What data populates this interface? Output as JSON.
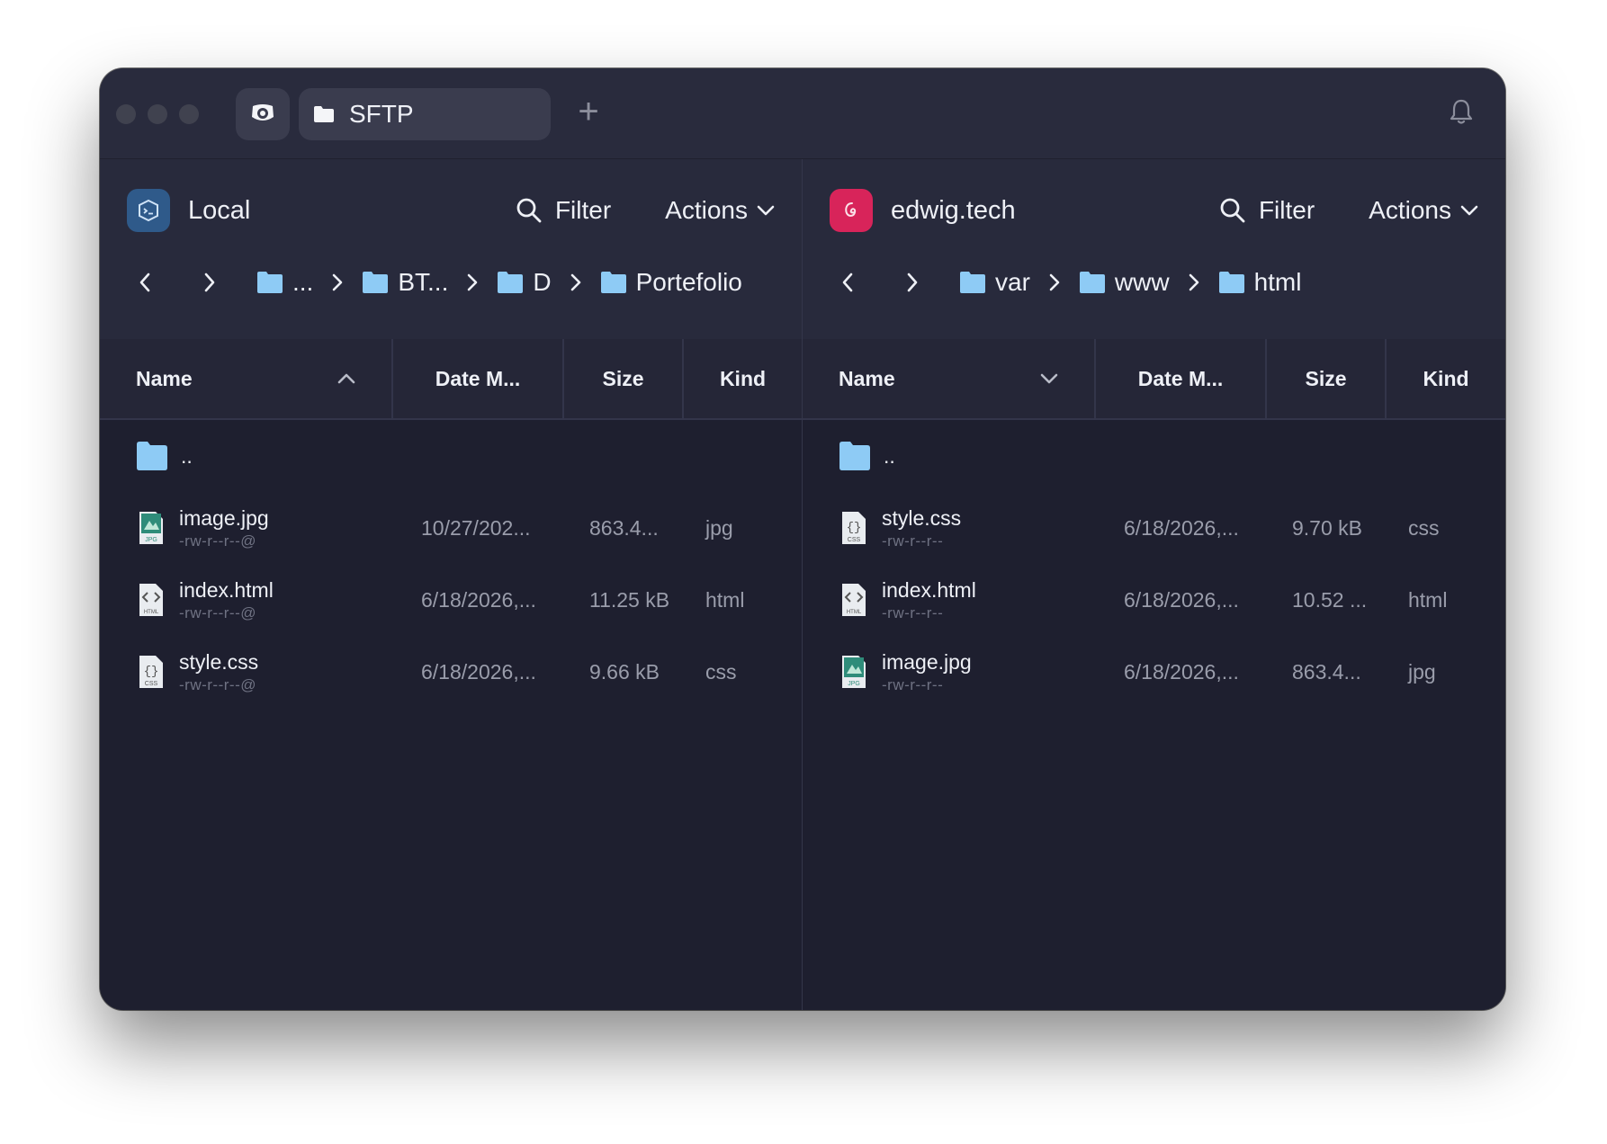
{
  "titlebar": {
    "tab_label": "SFTP",
    "new_tab_symbol": "+",
    "icons": [
      "app-logo-icon",
      "folder-icon",
      "bell-icon"
    ]
  },
  "left": {
    "host": "Local",
    "filter_label": "Filter",
    "actions_label": "Actions",
    "crumbs": [
      "...",
      "BT...",
      "D",
      "Portefolio"
    ],
    "columns": [
      "Name",
      "Date M...",
      "Size",
      "Kind"
    ],
    "sort_indicator": "ascending",
    "parent_label": "..",
    "files": [
      {
        "name": "image.jpg",
        "perm": "-rw-r--r--@",
        "date": "10/27/202...",
        "size": "863.4...",
        "kind": "jpg",
        "icon": "jpg-file-icon"
      },
      {
        "name": "index.html",
        "perm": "-rw-r--r--@",
        "date": "6/18/2026,...",
        "size": "11.25 kB",
        "kind": "html",
        "icon": "html-file-icon"
      },
      {
        "name": "style.css",
        "perm": "-rw-r--r--@",
        "date": "6/18/2026,...",
        "size": "9.66 kB",
        "kind": "css",
        "icon": "css-file-icon"
      }
    ]
  },
  "right": {
    "host": "edwig.tech",
    "filter_label": "Filter",
    "actions_label": "Actions",
    "crumbs": [
      "var",
      "www",
      "html"
    ],
    "columns": [
      "Name",
      "Date M...",
      "Size",
      "Kind"
    ],
    "sort_indicator": "descending",
    "parent_label": "..",
    "files": [
      {
        "name": "style.css",
        "perm": "-rw-r--r--",
        "date": "6/18/2026,...",
        "size": "9.70 kB",
        "kind": "css",
        "icon": "css-file-icon"
      },
      {
        "name": "index.html",
        "perm": "-rw-r--r--",
        "date": "6/18/2026,...",
        "size": "10.52 ...",
        "kind": "html",
        "icon": "html-file-icon"
      },
      {
        "name": "image.jpg",
        "perm": "-rw-r--r--",
        "date": "6/18/2026,...",
        "size": "863.4...",
        "kind": "jpg",
        "icon": "jpg-file-icon"
      }
    ]
  },
  "colors": {
    "window_bg": "#1f2032",
    "titlebar_bg": "#292b3d",
    "folder_blue": "#8ecbf5",
    "local_host_accent": "#2f5a8a",
    "remote_host_accent": "#d8245a"
  }
}
